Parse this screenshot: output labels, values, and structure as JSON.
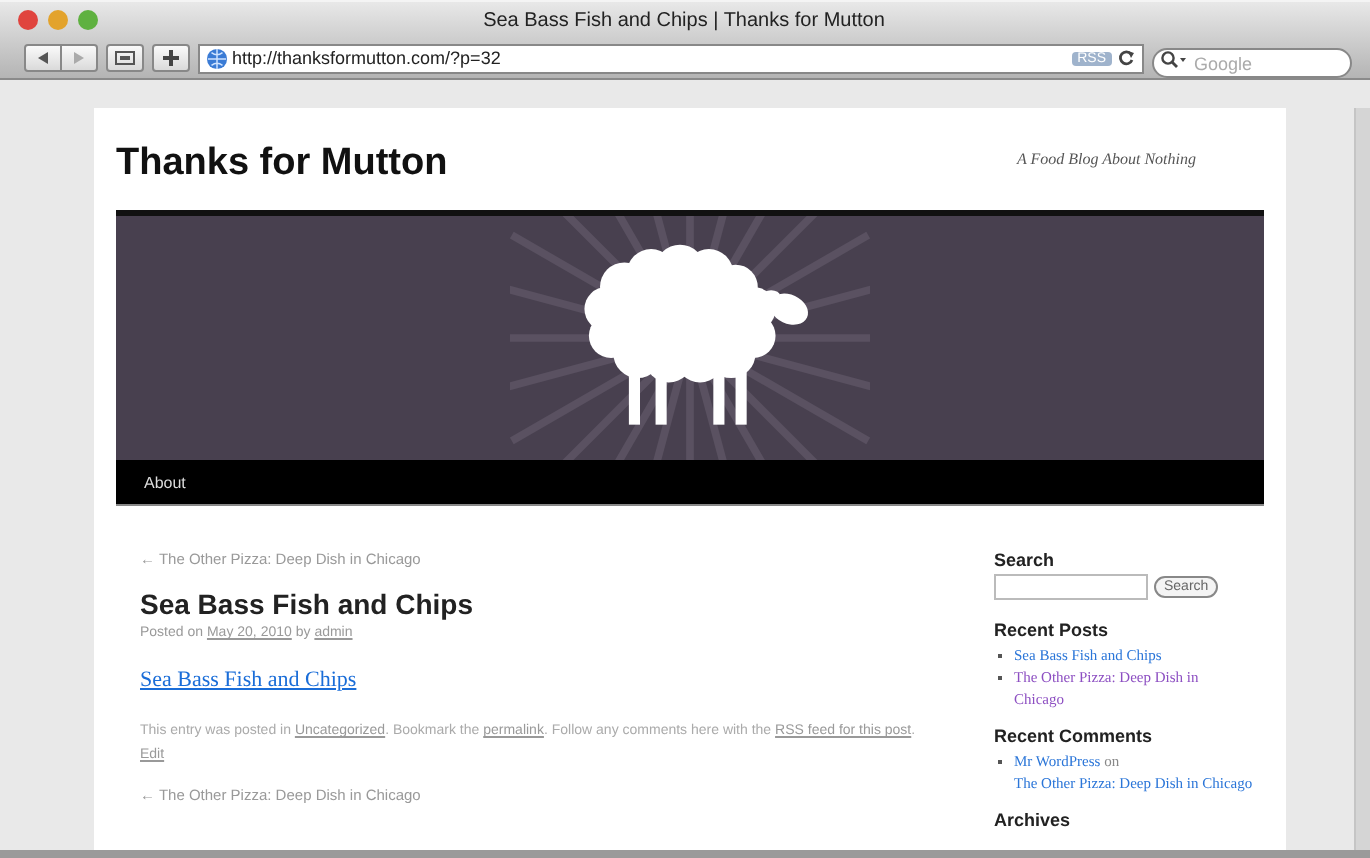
{
  "window": {
    "title": "Sea Bass Fish and Chips | Thanks for Mutton"
  },
  "toolbar": {
    "address": "http://thanksformutton.com/?p=32",
    "rss_badge": "RSS",
    "search_placeholder": "Google"
  },
  "site": {
    "title": "Thanks for Mutton",
    "tagline": "A Food Blog About Nothing"
  },
  "nav": [
    {
      "label": "About"
    }
  ],
  "post": {
    "prev_link_top": "← The Other Pizza: Deep Dish in Chicago",
    "title": "Sea Bass Fish and Chips",
    "meta": [
      {
        "kind": "text",
        "text": "Posted on "
      },
      {
        "kind": "link",
        "text": "May 20, 2010"
      },
      {
        "kind": "text",
        "text": " by "
      },
      {
        "kind": "link",
        "text": "admin"
      }
    ],
    "content_link": "Sea Bass Fish and Chips",
    "footer": [
      {
        "kind": "text",
        "text": "This entry was posted in "
      },
      {
        "kind": "link",
        "text": "Uncategorized"
      },
      {
        "kind": "text",
        "text": ". Bookmark the "
      },
      {
        "kind": "link",
        "text": "permalink"
      },
      {
        "kind": "text",
        "text": ". Follow any comments here with the "
      },
      {
        "kind": "link",
        "text": "RSS feed for this post"
      },
      {
        "kind": "text",
        "text": ". "
      },
      {
        "kind": "link",
        "text": "Edit"
      }
    ],
    "prev_link_bottom": "← The Other Pizza: Deep Dish in Chicago"
  },
  "sidebar": {
    "search_heading": "Search",
    "search_button": "Search",
    "recent_posts_heading": "Recent Posts",
    "recent_posts": [
      {
        "label": "Sea Bass Fish and Chips",
        "visited": false
      },
      {
        "label": "The Other Pizza: Deep Dish in Chicago",
        "visited": true
      }
    ],
    "recent_comments_heading": "Recent Comments",
    "recent_comments": [
      [
        {
          "kind": "link",
          "text": "Mr WordPress"
        },
        {
          "kind": "text",
          "text": " on "
        },
        {
          "kind": "link",
          "text": "The Other Pizza: Deep Dish in Chicago"
        }
      ]
    ],
    "archives_heading": "Archives"
  }
}
